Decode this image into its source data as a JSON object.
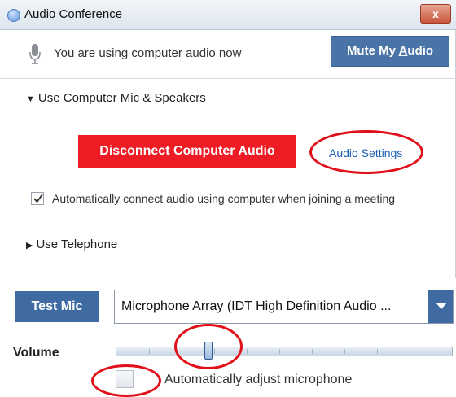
{
  "window": {
    "title": "Audio Conference",
    "close_label": "x"
  },
  "status": {
    "message": "You are using computer audio now",
    "mute_button": {
      "prefix": "Mute My ",
      "accel": "A",
      "suffix": "udio"
    }
  },
  "computer_audio": {
    "section_label": "Use Computer Mic & Speakers",
    "disconnect_label": "Disconnect Computer Audio",
    "settings_link": "Audio Settings",
    "auto_connect_label": "Automatically connect audio using computer when joining a meeting",
    "auto_connect_checked": true
  },
  "telephone": {
    "section_label": "Use Telephone"
  },
  "mic_panel": {
    "test_mic_label": "Test Mic",
    "mic_select_value": "Microphone Array (IDT High Definition Audio ...",
    "volume_label": "Volume",
    "volume_level_fraction": 0.27,
    "auto_adjust_label": "Automatically adjust microphone",
    "auto_adjust_checked": false
  },
  "colors": {
    "accent_blue": "#4a74a8",
    "disconnect_red": "#ee1c25",
    "annotation_red": "#e0101a",
    "link_blue": "#1a5fb4"
  },
  "icons": [
    "app-icon",
    "close-icon",
    "microphone-icon",
    "checkmark-icon",
    "triangle-down-icon",
    "triangle-right-icon",
    "dropdown-arrow-icon"
  ]
}
